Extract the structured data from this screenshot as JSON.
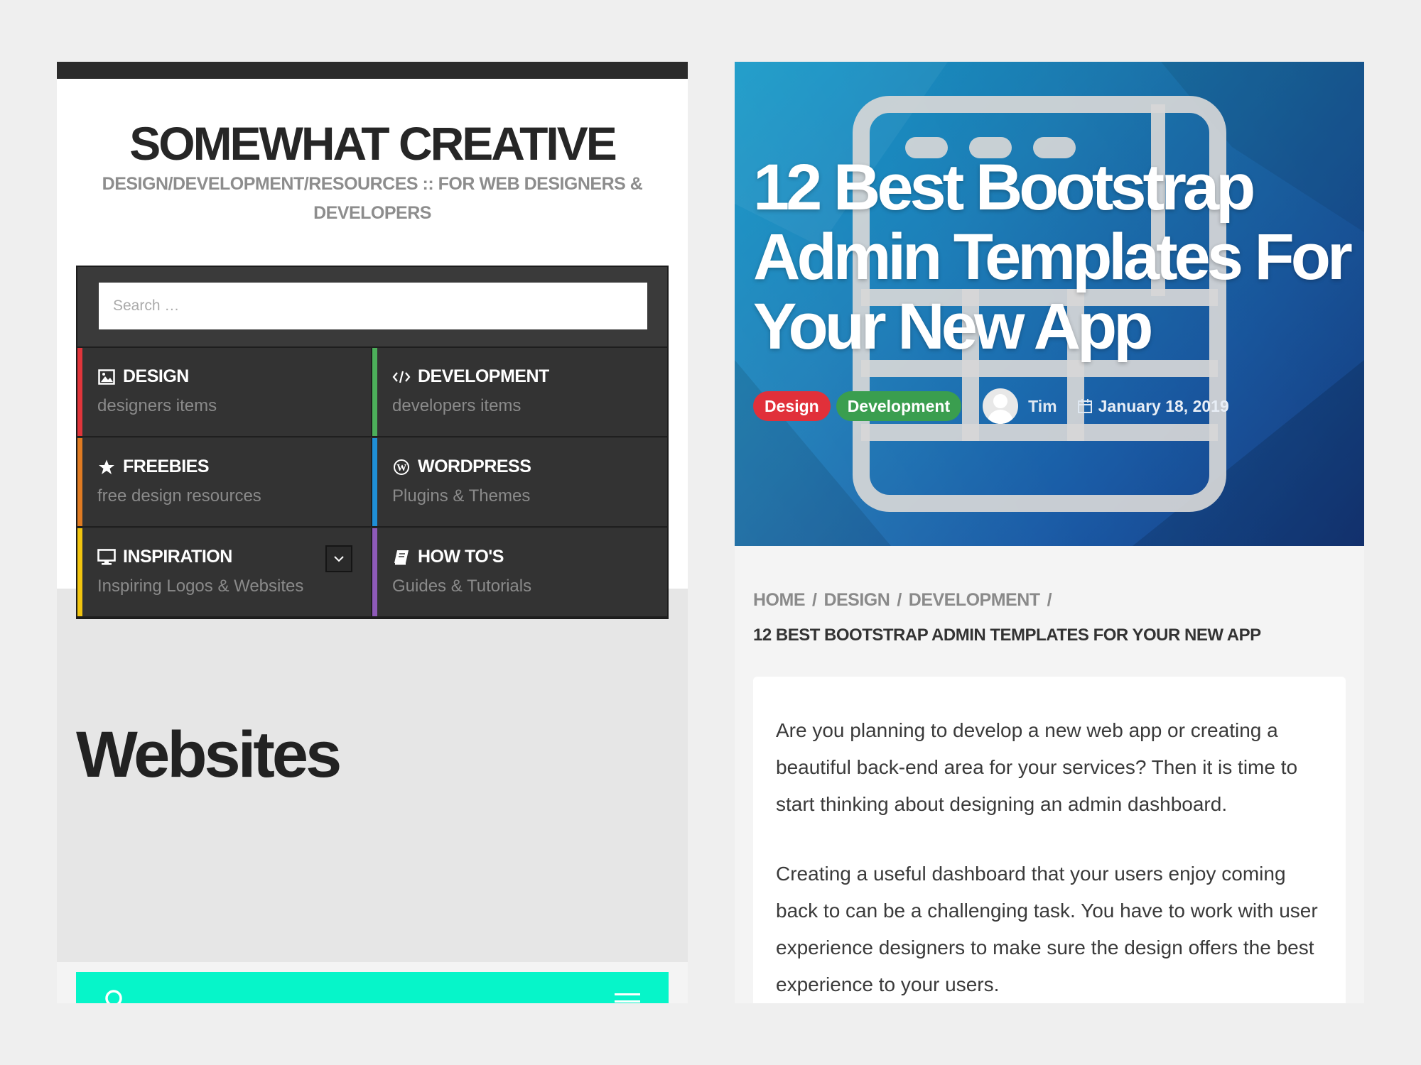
{
  "left": {
    "site_title": "SOMEWHAT CREATIVE",
    "tagline": "DESIGN/DEVELOPMENT/RESOURCES :: FOR WEB DESIGNERS & DEVELOPERS",
    "search_placeholder": "Search …",
    "categories": [
      {
        "title": "DESIGN",
        "subtitle": "designers items",
        "icon": "image-icon",
        "color": "#e0353b"
      },
      {
        "title": "DEVELOPMENT",
        "subtitle": "developers items",
        "icon": "code-icon",
        "color": "#4caf5a"
      },
      {
        "title": "FREEBIES",
        "subtitle": "free design resources",
        "icon": "star-icon",
        "color": "#e07b22"
      },
      {
        "title": "WORDPRESS",
        "subtitle": "Plugins & Themes",
        "icon": "wordpress-icon",
        "color": "#1f8fd6"
      },
      {
        "title": "INSPIRATION",
        "subtitle": "Inspiring Logos & Websites",
        "icon": "monitor-icon",
        "color": "#f1c40f"
      },
      {
        "title": "HOW TO'S",
        "subtitle": "Guides & Tutorials",
        "icon": "book-icon",
        "color": "#8e5ab8"
      }
    ],
    "section_title": "Websites",
    "teal_bar_color": "#06f5c9"
  },
  "right": {
    "hero_title": "12 Best Bootstrap Admin Templates For Your New App",
    "tags": [
      "Design",
      "Development"
    ],
    "author": "Tim",
    "date": "January 18, 2019",
    "breadcrumb": [
      "HOME",
      "DESIGN",
      "DEVELOPMENT"
    ],
    "breadcrumb_current": "12 BEST BOOTSTRAP ADMIN TEMPLATES FOR YOUR NEW APP",
    "paragraphs": [
      "Are you planning to develop a new web app or creating a beautiful back-end area for your services? Then it is time to start thinking about designing an admin dashboard.",
      "Creating a useful dashboard that your users enjoy coming back to can be a challenging task. You have to work with user experience designers to make sure the design offers the best experience to your users."
    ]
  }
}
